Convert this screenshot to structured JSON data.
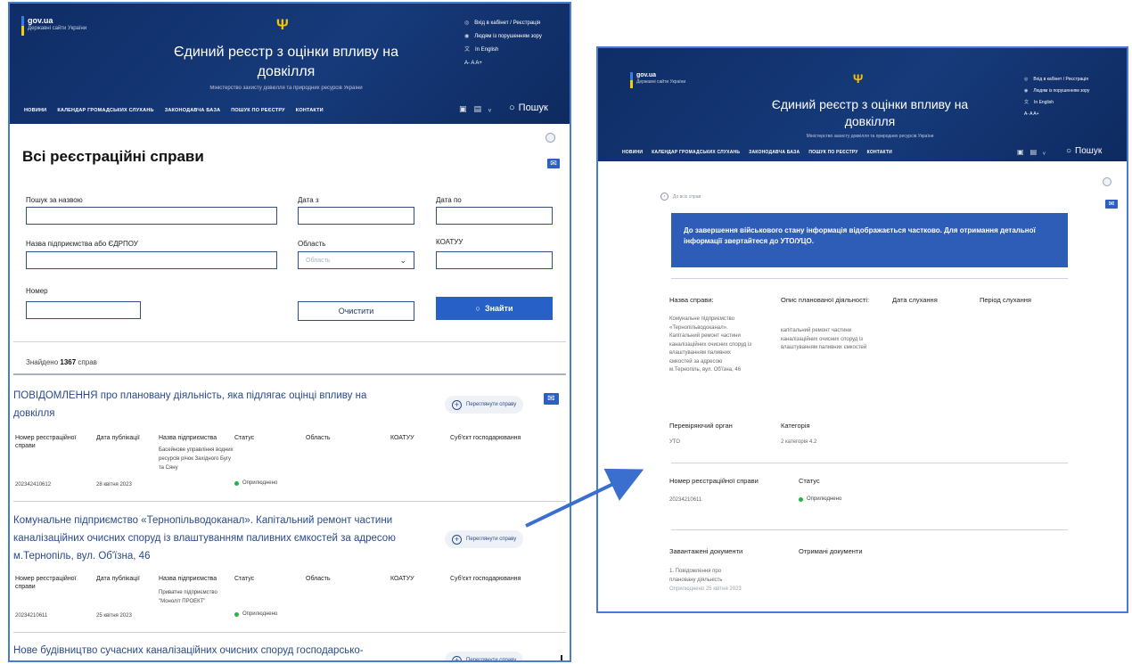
{
  "header": {
    "brand_name": "gov.ua",
    "brand_sub": "Державні сайти України",
    "title_line1": "Єдиний реєстр з оцінки впливу на",
    "title_line2": "довкілля",
    "ministry": "Міністерство захисту довкілля та природних ресурсів України",
    "login": "Вхід в кабінет / Реєстрація",
    "accessibility": "Людям із порушенням зору",
    "english": "In English",
    "font_sizes": "A- A A+",
    "nav": [
      "НОВИНИ",
      "КАЛЕНДАР ГРОМАДСЬКИХ СЛУХАНЬ",
      "ЗАКОНОДАВЧА БАЗА",
      "ПОШУК ПО РЕЄСТРУ",
      "КОНТАКТИ"
    ],
    "search": "Пошук"
  },
  "search_page": {
    "heading": "Всі реєстраційні справи",
    "labels": {
      "name": "Пошук за назвою",
      "date_from": "Дата з",
      "date_to": "Дата по",
      "company": "Назва підприємства або ЄДРПОУ",
      "region": "Область",
      "koatuu": "КОАТУУ",
      "number": "Номер"
    },
    "region_placeholder": "Область",
    "clear_button": "Очистити",
    "find_button": "Знайти",
    "found_prefix": "Знайдено",
    "found_count": "1367",
    "found_suffix": "справ",
    "columns": [
      "Номер реєстраційної справи",
      "Дата публікації",
      "Назва підприємства",
      "Статус",
      "Область",
      "КОАТУУ",
      "Суб'єкт господарювання"
    ],
    "review_button": "Переглянути справу",
    "cases": [
      {
        "title": "ПОВІДОМЛЕННЯ про плановану діяльність, яка підлягає оцінці впливу на довкілля",
        "number": "20234241061​2",
        "date": "28 квітня 2023",
        "company": "Басейнове управління водних ресурсів річок Західного Бугу та Сяну",
        "status": "Оприлюднено"
      },
      {
        "title": "Комунальне підприємство «Тернопільводоканал». Капітальний ремонт частини каналізаційних очисних споруд із влаштуванням паливних ємкостей за адресою м.Тернопіль, вул. Об'їзна, 46",
        "number": "2023421061​1",
        "date": "25 квітня 2023",
        "company": "Приватне підприємство \"Моноліт ПРОЕКТ\"",
        "status": "Оприлюднено"
      },
      {
        "title": "Нове будівництво сучасних каналізаційних очисних споруд господарсько-"
      }
    ]
  },
  "detail_page": {
    "back": "До всіх справ",
    "notice": "До завершення військового стану інформація відображається частково. Для отримання детальної інформації звертайтеся до УТО/УЦО.",
    "case_name_label": "Назва справи:",
    "case_name_value": "Комунальне підприємство «Тернопільводоканал». Капітальний ремонт частини каналізаційних очисних споруд із влаштуванням паливних ємкостей за адресою м.Тернопіль, вул. Об'їзна, 46",
    "activity_label": "Опис планованої діяльності:",
    "activity_value": "капітальний ремонт частини каналізаційних очисних споруд із влаштуванням паливних ємкостей",
    "hearing_date_label": "Дата слухання",
    "hearing_period_label": "Період слухання",
    "authority_label": "Перевіряючий орган",
    "authority_value": "УТО",
    "category_label": "Категорія",
    "category_value": "2 категорія 4.2",
    "reg_number_label": "Номер реєстраційної справи",
    "reg_number_value": "2023421061​1",
    "status_label": "Статус",
    "status_value": "Оприлюднено",
    "uploaded_docs_label": "Завантажені документи",
    "received_docs_label": "Отримані документи",
    "doc_item": "1. Повідомлення про плановану діяльність",
    "doc_date": "Оприлюднено 25 квітня 2023"
  }
}
